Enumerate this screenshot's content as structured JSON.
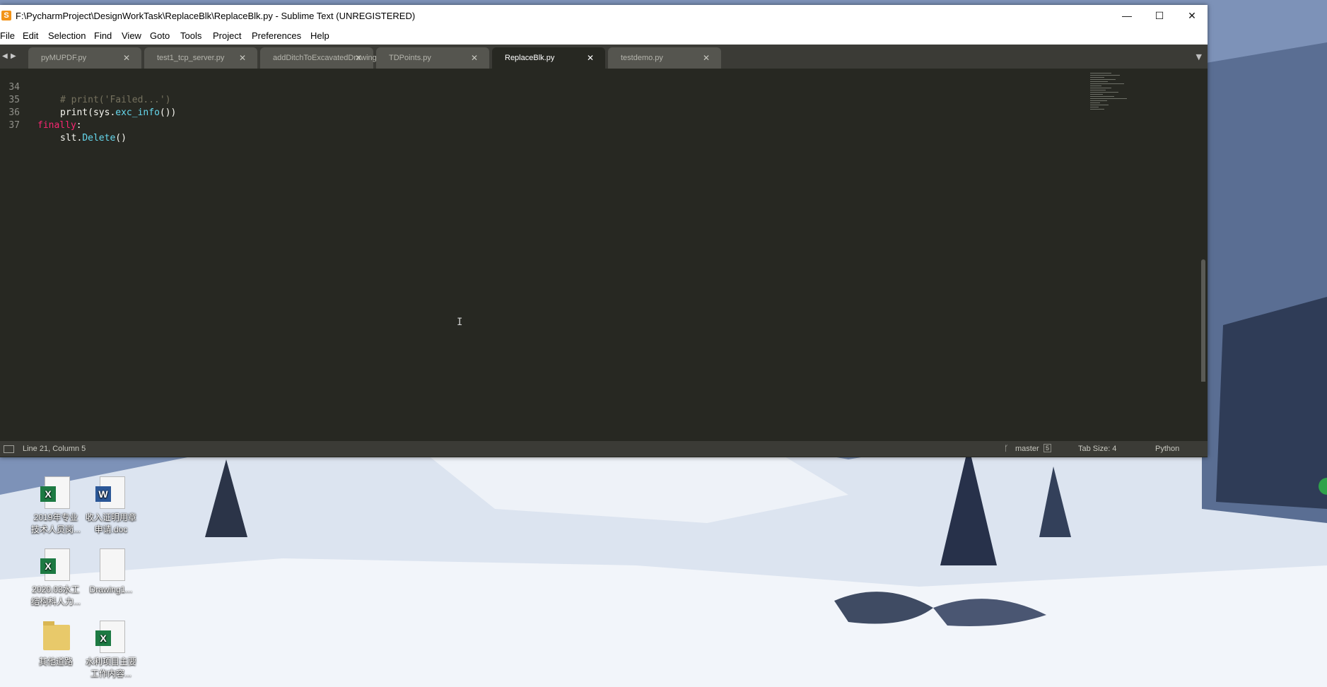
{
  "window": {
    "title": "F:\\PycharmProject\\DesignWorkTask\\ReplaceBlk\\ReplaceBlk.py - Sublime Text (UNREGISTERED)",
    "controls": {
      "minimize": "—",
      "maximize": "☐",
      "close": "✕"
    }
  },
  "menu": [
    "File",
    "Edit",
    "Selection",
    "Find",
    "View",
    "Goto",
    "Tools",
    "Project",
    "Preferences",
    "Help"
  ],
  "tabs": [
    {
      "label": "pyMUPDF.py",
      "active": false
    },
    {
      "label": "test1_tcp_server.py",
      "active": false
    },
    {
      "label": "addDitchToExcavatedDrawing.py",
      "active": false
    },
    {
      "label": "TDPoints.py",
      "active": false
    },
    {
      "label": "ReplaceBlk.py",
      "active": true
    },
    {
      "label": "testdemo.py",
      "active": false
    }
  ],
  "code": {
    "lines": [
      {
        "num": "34",
        "indent": "    ",
        "tokens": [
          {
            "t": "# print('Failed...')",
            "c": "cm"
          }
        ]
      },
      {
        "num": "35",
        "indent": "    ",
        "tokens": [
          {
            "t": "print(sys.",
            "c": ""
          },
          {
            "t": "exc_info",
            "c": "fn"
          },
          {
            "t": "())",
            "c": ""
          }
        ]
      },
      {
        "num": "36",
        "indent": "",
        "tokens": [
          {
            "t": "finally",
            "c": "kw"
          },
          {
            "t": ":",
            "c": ""
          }
        ]
      },
      {
        "num": "37",
        "indent": "    ",
        "tokens": [
          {
            "t": "slt.",
            "c": ""
          },
          {
            "t": "Delete",
            "c": "fn"
          },
          {
            "t": "()",
            "c": ""
          }
        ]
      }
    ]
  },
  "status": {
    "position": "Line 21, Column 5",
    "branch": "master",
    "branch_count": "5",
    "tab_size": "Tab Size: 4",
    "syntax": "Python"
  },
  "desktop_icons": [
    {
      "label": "2019年专业\n技术人员岗...",
      "kind": "excel"
    },
    {
      "label": "收入证明用章\n申请.doc",
      "kind": "word"
    },
    {
      "label": "2020.03水工\n结构科人力...",
      "kind": "excel"
    },
    {
      "label": "Drawing1...",
      "kind": "file"
    },
    {
      "label": "其他道路",
      "kind": "folder"
    },
    {
      "label": "水利项目主要\n工作内容...",
      "kind": "excel"
    }
  ],
  "colors": {
    "editor_bg": "#272822",
    "keyword": "#f92672",
    "function": "#66d9ef",
    "comment": "#75715e"
  }
}
